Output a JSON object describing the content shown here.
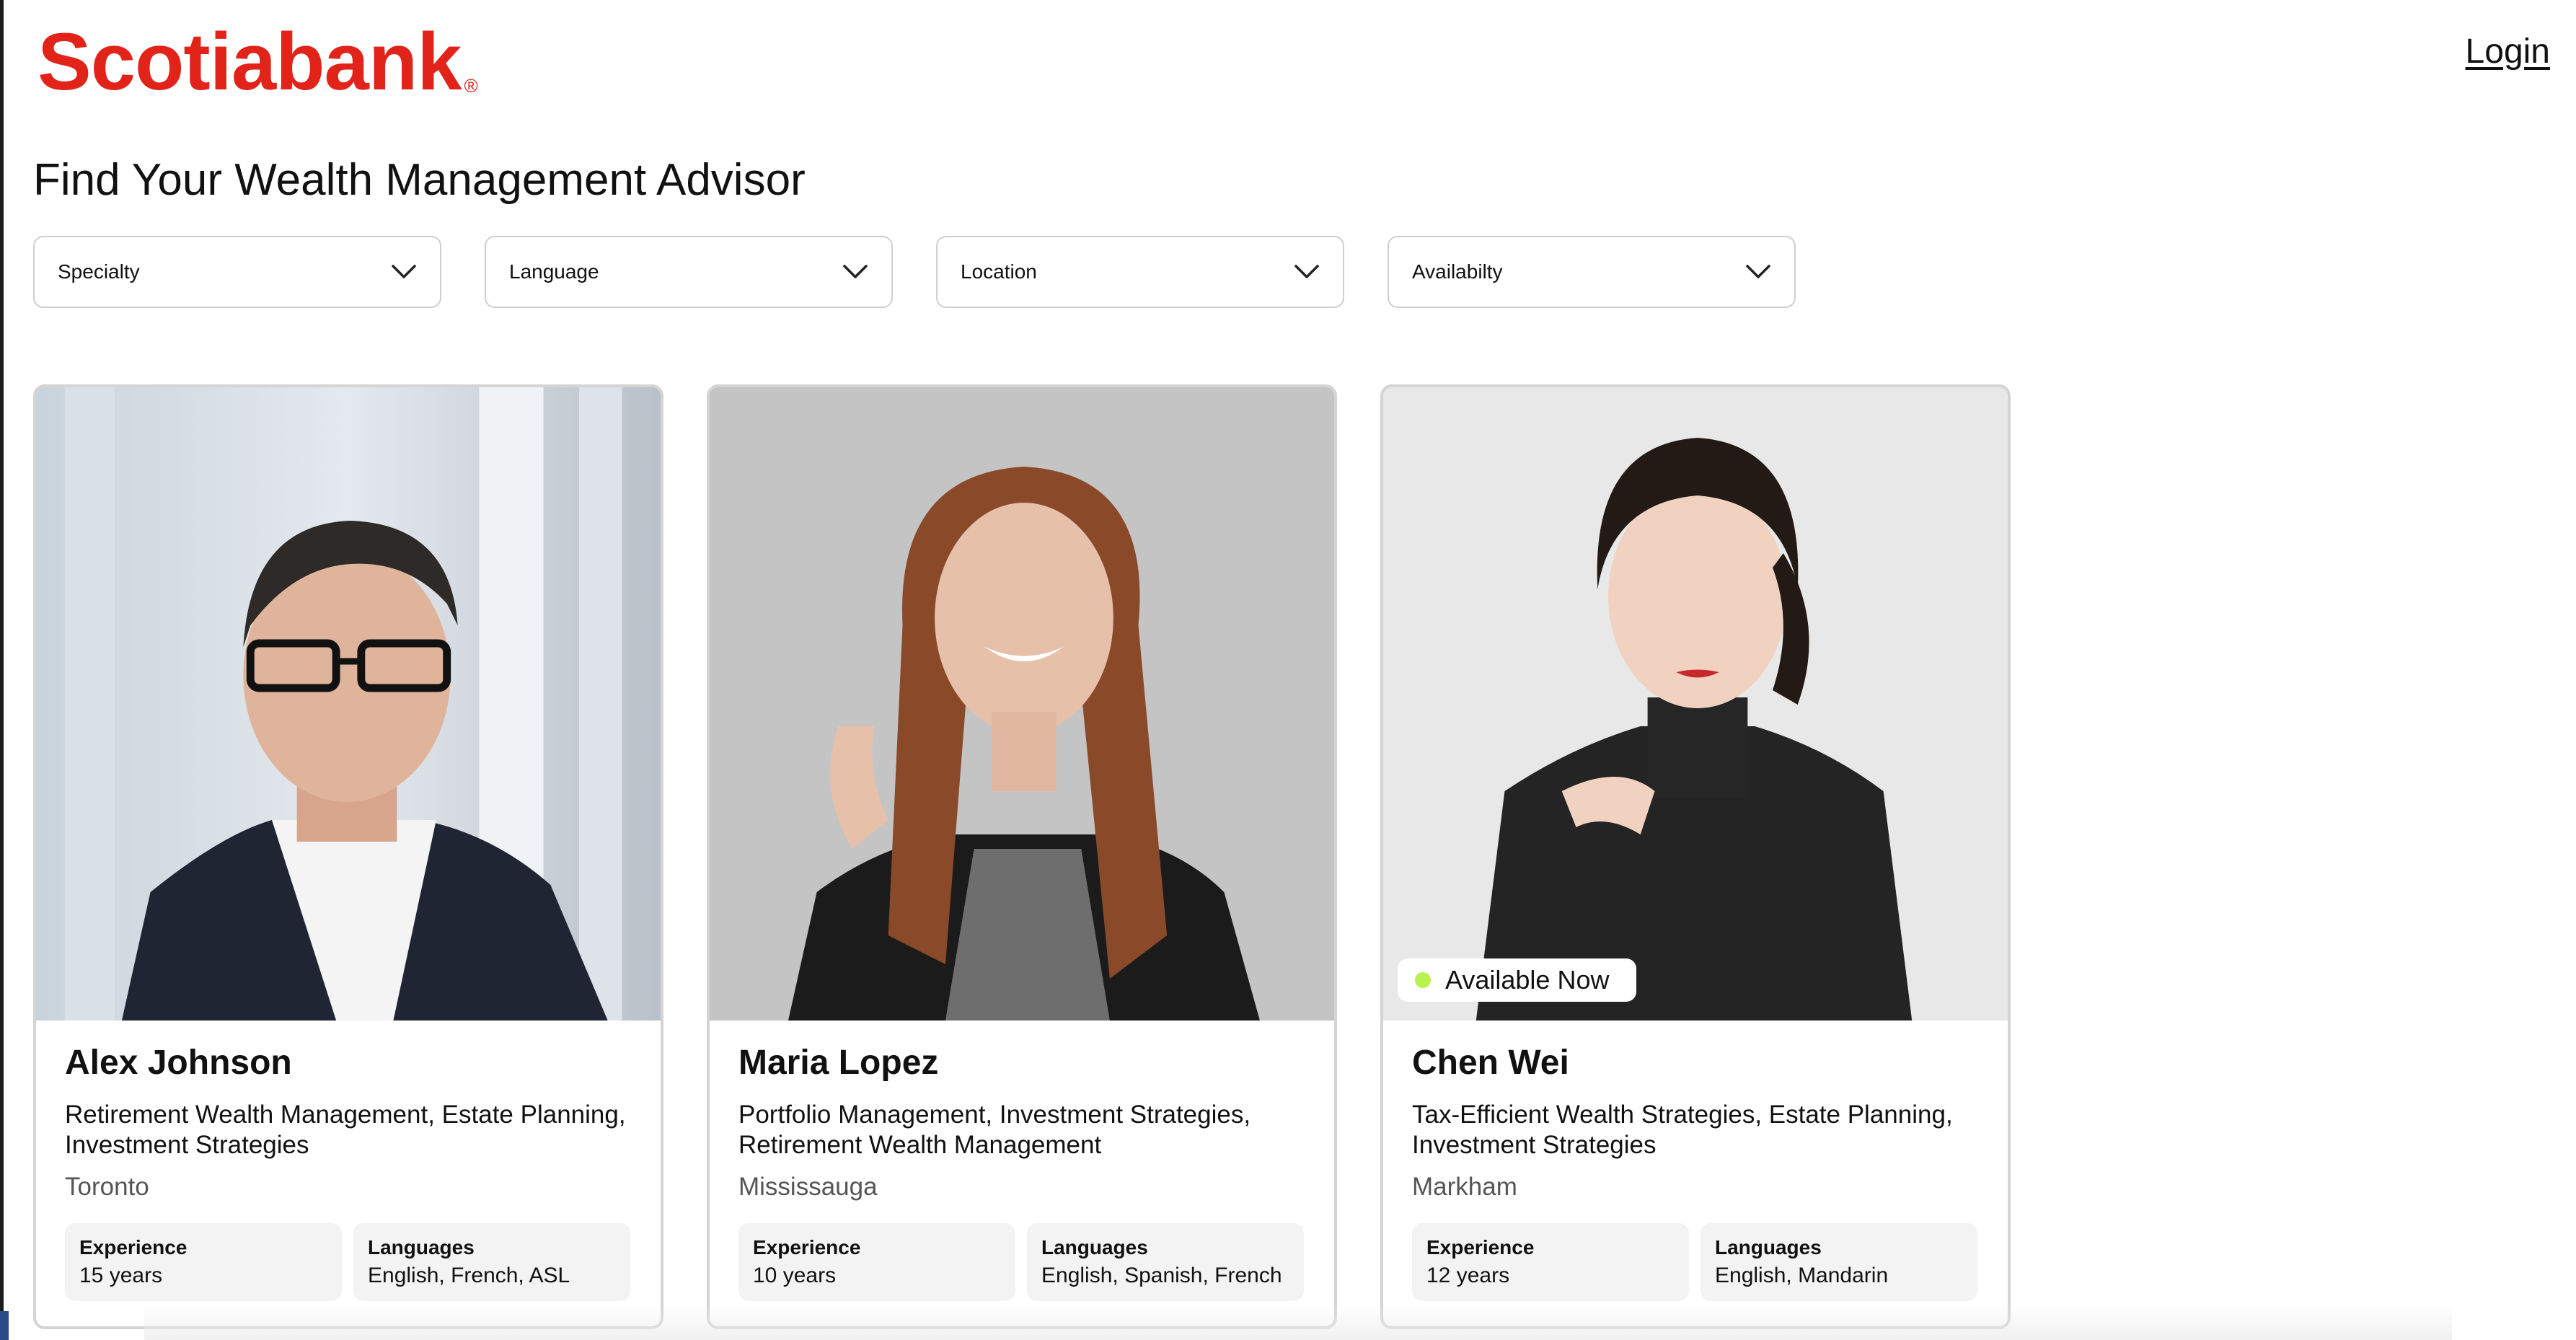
{
  "header": {
    "brand": "Scotiabank",
    "brand_mark": "®",
    "login_label": "Login"
  },
  "page": {
    "title": "Find Your Wealth Management Advisor"
  },
  "filters": [
    {
      "label": "Specialty",
      "icon": "chevron-down-icon"
    },
    {
      "label": "Language",
      "icon": "chevron-down-icon"
    },
    {
      "label": "Location",
      "icon": "chevron-down-icon"
    },
    {
      "label": "Availabilty",
      "icon": "chevron-down-icon"
    }
  ],
  "advisors": [
    {
      "name": "Alex Johnson",
      "specialties": "Retirement Wealth Management, Estate Planning, Investment Strategies",
      "location": "Toronto",
      "experience_label": "Experience",
      "experience_value": "15 years",
      "languages_label": "Languages",
      "languages_value": "English, French, ASL"
    },
    {
      "name": "Maria Lopez",
      "specialties": "Portfolio Management, Investment Strategies, Retirement Wealth Management",
      "location": "Mississauga",
      "experience_label": "Experience",
      "experience_value": "10 years",
      "languages_label": "Languages",
      "languages_value": "English, Spanish, French"
    },
    {
      "name": "Chen Wei",
      "badge": "Available Now",
      "specialties": "Tax-Efficient Wealth Strategies, Estate Planning, Investment Strategies",
      "location": "Markham",
      "experience_label": "Experience",
      "experience_value": "12 years",
      "languages_label": "Languages",
      "languages_value": "English, Mandarin"
    }
  ],
  "colors": {
    "brand_red": "#e2231a",
    "available_dot": "#b8f24a",
    "stat_background": "#f3f3f3"
  }
}
